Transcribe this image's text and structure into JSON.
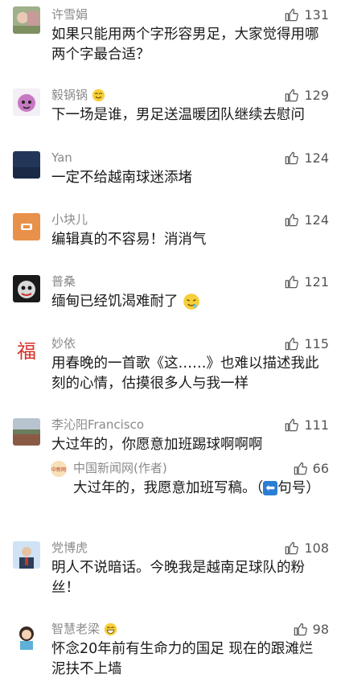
{
  "comments": [
    {
      "name": "许雪娟",
      "likes": "131",
      "text": "如果只能用两个字形容男足，大家觉得用哪两个字最合适？"
    },
    {
      "name": "毅锅锅",
      "likes": "129",
      "text": "下一场是谁，男足送温暖团队继续去慰问"
    },
    {
      "name": "Yan",
      "likes": "124",
      "text": "一定不给越南球迷添堵"
    },
    {
      "name": "小块儿",
      "likes": "124",
      "text": "编辑真的不容易！消消气"
    },
    {
      "name": "普桑",
      "likes": "121",
      "text": "缅甸已经饥渴难耐了"
    },
    {
      "name": "妙依",
      "likes": "115",
      "text": "用春晚的一首歌《这……》也难以描述我此刻的心情，估摸很多人与我一样"
    },
    {
      "name": "李沁阳Francisco",
      "likes": "111",
      "text": "大过年的，你愿意加班踢球啊啊啊",
      "reply": {
        "name": "中国新闻网(作者)",
        "likes": "66",
        "text": "大过年的，我愿意加班写稿。（",
        "text_tail": "句号）",
        "avatar_text": "中新网"
      }
    },
    {
      "name": "党博虎",
      "likes": "108",
      "text": "明人不说暗话。今晚我是越南足球队的粉丝！"
    },
    {
      "name": "智慧老梁",
      "likes": "98",
      "text": "怀念20年前有生命力的国足 现在的跟滩烂泥扶不上墙"
    }
  ],
  "icons": {
    "like": "thumbs-up-icon",
    "reply_arrow": "left-arrow-emoji-icon"
  },
  "avatar_glyphs": {
    "miaoyi": "福"
  },
  "colors": {
    "name": "#8a8a8a",
    "text": "#1a1a1a",
    "like": "#555555"
  }
}
